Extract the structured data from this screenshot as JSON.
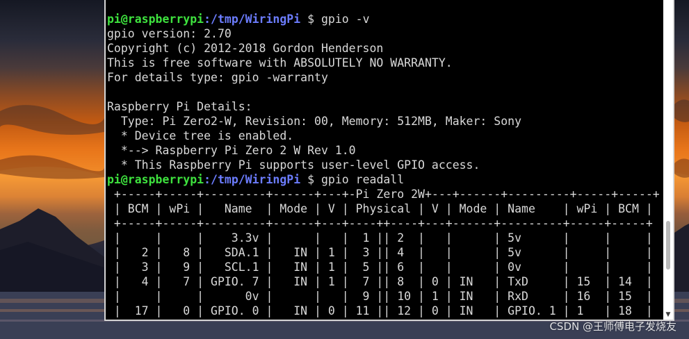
{
  "colors": {
    "terminal_bg": "#000000",
    "text": "#d9d9d9",
    "prompt_user": "#3ee23e",
    "prompt_path": "#6c7dff"
  },
  "terminal": {
    "prompt": {
      "user_host": "pi@raspberrypi",
      "path": ":/tmp/WiringPi",
      "symbol": " $ "
    },
    "lines": [
      {
        "type": "prompt",
        "command": "gpio -v"
      },
      {
        "type": "text",
        "text": "gpio version: 2.70"
      },
      {
        "type": "text",
        "text": "Copyright (c) 2012-2018 Gordon Henderson"
      },
      {
        "type": "text",
        "text": "This is free software with ABSOLUTELY NO WARRANTY."
      },
      {
        "type": "text",
        "text": "For details type: gpio -warranty"
      },
      {
        "type": "text",
        "text": ""
      },
      {
        "type": "text",
        "text": "Raspberry Pi Details:"
      },
      {
        "type": "text",
        "text": "  Type: Pi Zero2-W, Revision: 00, Memory: 512MB, Maker: Sony"
      },
      {
        "type": "text",
        "text": "  * Device tree is enabled."
      },
      {
        "type": "text",
        "text": "  *--> Raspberry Pi Zero 2 W Rev 1.0"
      },
      {
        "type": "text",
        "text": "  * This Raspberry Pi supports user-level GPIO access."
      },
      {
        "type": "prompt",
        "command": "gpio readall"
      },
      {
        "type": "text",
        "text": " +-----+-----+---------+------+---+-Pi Zero 2W+---+------+---------+-----+-----+"
      },
      {
        "type": "text",
        "text": " | BCM | wPi |   Name  | Mode | V | Physical | V | Mode | Name    | wPi | BCM |"
      },
      {
        "type": "text",
        "text": " +-----+-----+---------+------+---+----++----+---+------+---------+-----+-----+"
      },
      {
        "type": "text",
        "text": " |     |     |    3.3v |      |   |  1 || 2  |   |      | 5v      |     |     |"
      },
      {
        "type": "text",
        "text": " |   2 |   8 |   SDA.1 |   IN | 1 |  3 || 4  |   |      | 5v      |     |     |"
      },
      {
        "type": "text",
        "text": " |   3 |   9 |   SCL.1 |   IN | 1 |  5 || 6  |   |      | 0v      |     |     |"
      },
      {
        "type": "text",
        "text": " |   4 |   7 | GPIO. 7 |   IN | 1 |  7 || 8  | 0 | IN   | TxD     | 15  | 14  |"
      },
      {
        "type": "text",
        "text": " |     |     |      0v |      |   |  9 || 10 | 1 | IN   | RxD     | 16  | 15  |"
      },
      {
        "type": "text",
        "text": " |  17 |   0 | GPIO. 0 |   IN | 0 | 11 || 12 | 0 | IN   | GPIO. 1 | 1   | 18  |"
      }
    ]
  },
  "scrollbar": {
    "down_arrow": "▼"
  },
  "watermark": "CSDN @王师傅电子发烧友"
}
